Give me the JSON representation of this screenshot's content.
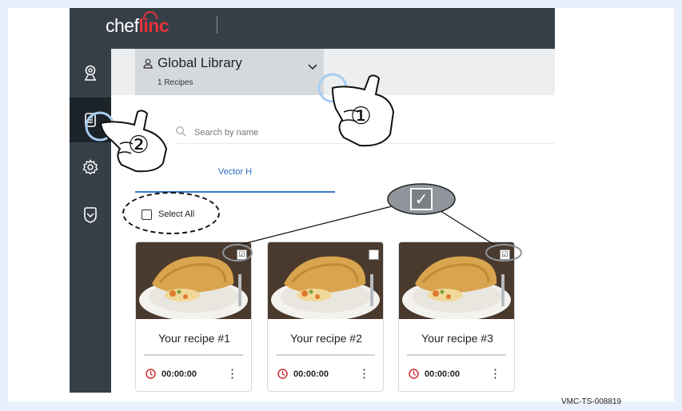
{
  "app": {
    "logo_text": "chef",
    "logo_accent": "linc"
  },
  "library": {
    "title": "Global Library",
    "count": "1 Recipes"
  },
  "search": {
    "placeholder": "Search by name"
  },
  "tab": {
    "label": "Vector H"
  },
  "select_all": {
    "label": "Select All"
  },
  "cards": [
    {
      "title": "Your recipe #1",
      "time": "00:00:00",
      "checked": true
    },
    {
      "title": "Your recipe #2",
      "time": "00:00:00",
      "checked": false
    },
    {
      "title": "Your recipe #3",
      "time": "00:00:00",
      "checked": true
    }
  ],
  "sidebar_icons": [
    "location-icon",
    "library-icon",
    "gear-icon",
    "shield-icon"
  ],
  "callouts": {
    "one": "①",
    "two": "②",
    "zoom_check": "✓"
  },
  "doc_id": "VMC-TS-008819",
  "colors": {
    "topbar": "#363f48",
    "accent": "#e8313a",
    "tab_blue": "#3b7ac9"
  }
}
